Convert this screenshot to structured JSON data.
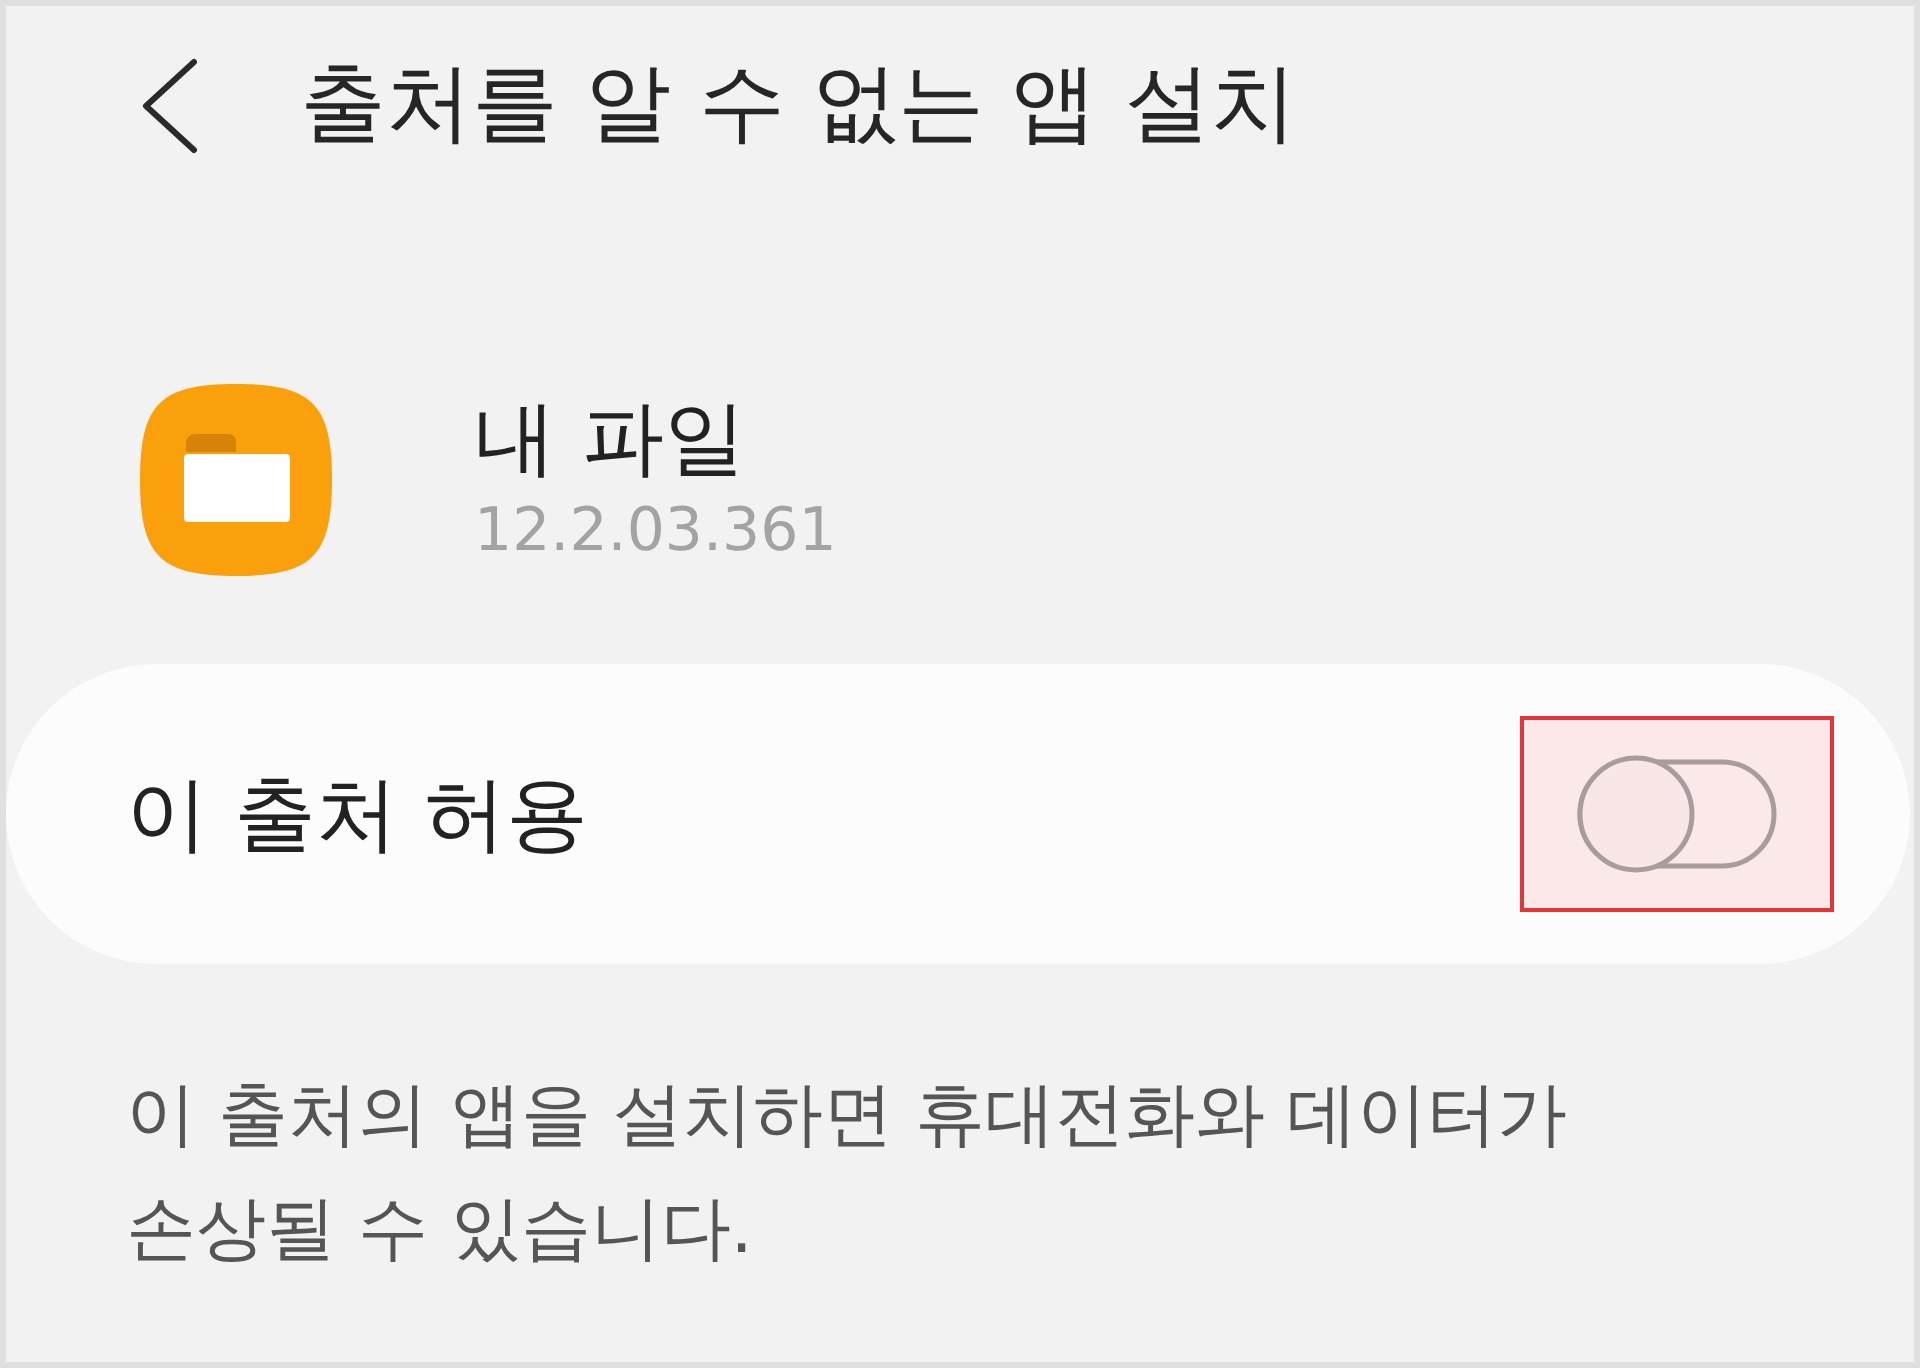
{
  "header": {
    "title": "출처를 알 수 없는 앱 설치"
  },
  "app": {
    "name": "내 파일",
    "version": "12.2.03.361"
  },
  "allow_source": {
    "label": "이 출처 허용",
    "on": false,
    "highlighted": true
  },
  "description": "이 출처의 앱을 설치하면 휴대전화와 데이터가 손상될 수 있습니다."
}
